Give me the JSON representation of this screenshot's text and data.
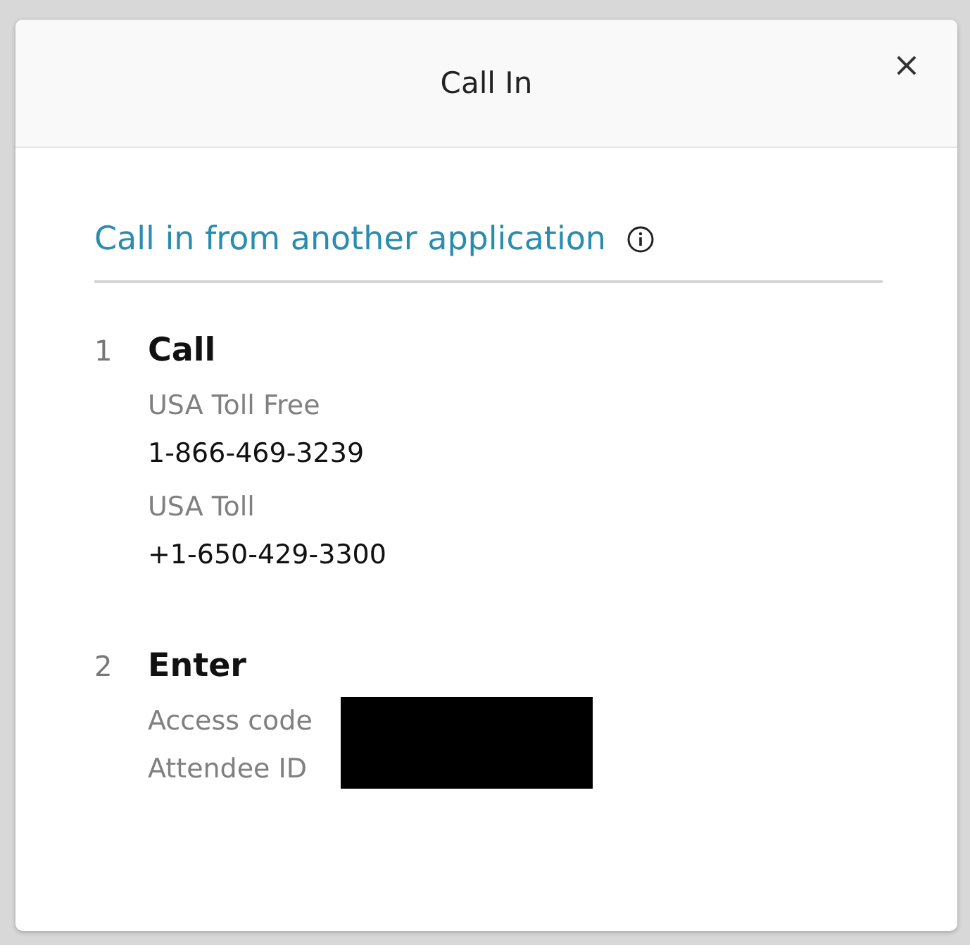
{
  "dialog": {
    "title": "Call In",
    "close": "×"
  },
  "section": {
    "heading": "Call in from another application"
  },
  "steps": [
    {
      "number": "1",
      "title": "Call",
      "kind": "numbers",
      "entries": [
        {
          "label": "USA Toll Free",
          "value": "1-866-469-3239"
        },
        {
          "label": "USA Toll",
          "value": "+1-650-429-3300"
        }
      ]
    },
    {
      "number": "2",
      "title": "Enter",
      "kind": "codes",
      "labels": [
        "Access code",
        "Attendee ID"
      ]
    }
  ]
}
